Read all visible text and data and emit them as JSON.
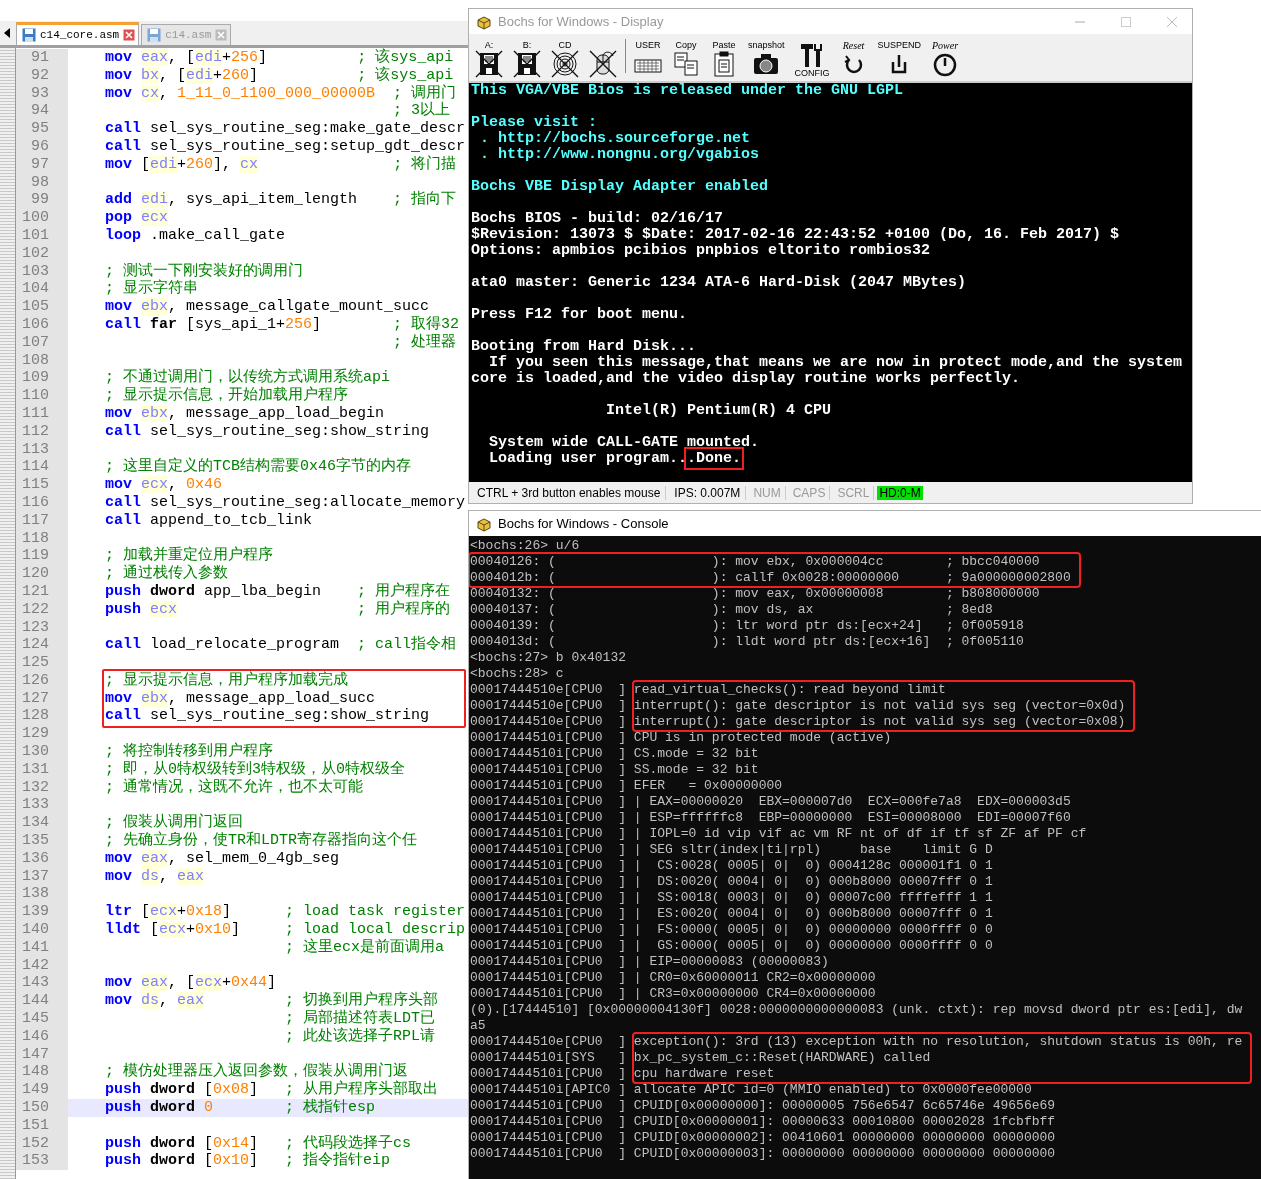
{
  "editor": {
    "tabs": [
      {
        "label": "c14_core.asm",
        "selected": true
      },
      {
        "label": "c14.asm",
        "selected": false
      }
    ],
    "blocks": [
      {
        "boxed": false,
        "lines": [
          {
            "num": "91",
            "current": false,
            "parts": [
              {
                "text": "mov ",
                "kind": "kw"
              },
              {
                "text": "eax",
                "kind": "reg"
              },
              {
                "text": ", [",
                "kind": "txt"
              },
              {
                "text": "edi",
                "kind": "reg"
              },
              {
                "text": "+",
                "kind": "txt"
              },
              {
                "text": "256",
                "kind": "num"
              },
              {
                "text": "]          ",
                "kind": "txt"
              },
              {
                "text": "; 该sys_api",
                "kind": "cmt"
              }
            ]
          },
          {
            "num": "92",
            "current": false,
            "parts": [
              {
                "text": "mov ",
                "kind": "kw"
              },
              {
                "text": "bx",
                "kind": "reg"
              },
              {
                "text": ", [",
                "kind": "txt"
              },
              {
                "text": "edi",
                "kind": "reg"
              },
              {
                "text": "+",
                "kind": "txt"
              },
              {
                "text": "260",
                "kind": "num"
              },
              {
                "text": "]           ",
                "kind": "txt"
              },
              {
                "text": "; 该sys_api",
                "kind": "cmt"
              }
            ]
          },
          {
            "num": "93",
            "current": false,
            "parts": [
              {
                "text": "mov ",
                "kind": "kw"
              },
              {
                "text": "cx",
                "kind": "reg"
              },
              {
                "text": ", ",
                "kind": "txt"
              },
              {
                "text": "1_11_0_1100_000_00000B",
                "kind": "num"
              },
              {
                "text": "  ; 调用门",
                "kind": "cmt"
              }
            ]
          },
          {
            "num": "94",
            "current": false,
            "parts": [
              {
                "text": "                                ; 3以上",
                "kind": "cmt"
              }
            ]
          },
          {
            "num": "95",
            "current": false,
            "parts": [
              {
                "text": "call",
                "kind": "kw"
              },
              {
                "text": " sel_sys_routine_seg:make_gate_descr",
                "kind": "txt"
              }
            ]
          },
          {
            "num": "96",
            "current": false,
            "parts": [
              {
                "text": "call",
                "kind": "kw"
              },
              {
                "text": " sel_sys_routine_seg:setup_gdt_descr",
                "kind": "txt"
              }
            ]
          },
          {
            "num": "97",
            "current": false,
            "parts": [
              {
                "text": "mov",
                "kind": "kw"
              },
              {
                "text": " [",
                "kind": "txt"
              },
              {
                "text": "edi",
                "kind": "reg"
              },
              {
                "text": "+",
                "kind": "txt"
              },
              {
                "text": "260",
                "kind": "num"
              },
              {
                "text": "], ",
                "kind": "txt"
              },
              {
                "text": "cx",
                "kind": "reg"
              },
              {
                "text": "               ; 将门描",
                "kind": "cmt"
              }
            ]
          },
          {
            "num": "98",
            "current": false
          },
          {
            "num": "99",
            "current": false,
            "parts": [
              {
                "text": "add ",
                "kind": "kw"
              },
              {
                "text": "edi",
                "kind": "reg"
              },
              {
                "text": ", sys_api_item_length    ",
                "kind": "txt"
              },
              {
                "text": "; 指向下",
                "kind": "cmt"
              }
            ]
          },
          {
            "num": "100",
            "current": false,
            "parts": [
              {
                "text": "pop ",
                "kind": "kw"
              },
              {
                "text": "ecx",
                "kind": "reg"
              }
            ]
          },
          {
            "num": "101",
            "current": false,
            "parts": [
              {
                "text": "loop",
                "kind": "kw"
              },
              {
                "text": " .make_call_gate",
                "kind": "txt"
              }
            ]
          },
          {
            "num": "102",
            "current": false
          },
          {
            "num": "103",
            "current": false,
            "parts": [
              {
                "text": "; 测试一下刚安装好的调用门",
                "kind": "cmt"
              }
            ]
          },
          {
            "num": "104",
            "current": false,
            "parts": [
              {
                "text": "; 显示字符串",
                "kind": "cmt"
              }
            ]
          },
          {
            "num": "105",
            "current": false,
            "parts": [
              {
                "text": "mov ",
                "kind": "kw"
              },
              {
                "text": "ebx",
                "kind": "reg"
              },
              {
                "text": ", message_callgate_mount_succ",
                "kind": "txt"
              }
            ]
          },
          {
            "num": "106",
            "current": false,
            "parts": [
              {
                "text": "call ",
                "kind": "kw"
              },
              {
                "text": "far",
                "kind": "kw2"
              },
              {
                "text": " [sys_api_1+",
                "kind": "txt"
              },
              {
                "text": "256",
                "kind": "num"
              },
              {
                "text": "]        ",
                "kind": "txt"
              },
              {
                "text": "; 取得32",
                "kind": "cmt"
              }
            ]
          },
          {
            "num": "107",
            "current": false,
            "parts": [
              {
                "text": "                                ; 处理器",
                "kind": "cmt"
              }
            ]
          },
          {
            "num": "108",
            "current": false
          },
          {
            "num": "109",
            "current": false,
            "parts": [
              {
                "text": "; 不通过调用门，以传统方式调用系统api",
                "kind": "cmt"
              }
            ]
          },
          {
            "num": "110",
            "current": false,
            "parts": [
              {
                "text": "; 显示提示信息，开始加载用户程序",
                "kind": "cmt"
              }
            ]
          },
          {
            "num": "111",
            "current": false,
            "parts": [
              {
                "text": "mov ",
                "kind": "kw"
              },
              {
                "text": "ebx",
                "kind": "reg"
              },
              {
                "text": ", message_app_load_begin",
                "kind": "txt"
              }
            ]
          },
          {
            "num": "112",
            "current": false,
            "parts": [
              {
                "text": "call",
                "kind": "kw"
              },
              {
                "text": " sel_sys_routine_seg:show_string",
                "kind": "txt"
              }
            ]
          },
          {
            "num": "113",
            "current": false
          },
          {
            "num": "114",
            "current": false,
            "parts": [
              {
                "text": "; 这里自定义的TCB结构需要0x46字节的内存",
                "kind": "cmt"
              }
            ]
          },
          {
            "num": "115",
            "current": false,
            "parts": [
              {
                "text": "mov ",
                "kind": "kw"
              },
              {
                "text": "ecx",
                "kind": "reg"
              },
              {
                "text": ", ",
                "kind": "txt"
              },
              {
                "text": "0x46",
                "kind": "num"
              }
            ]
          },
          {
            "num": "116",
            "current": false,
            "parts": [
              {
                "text": "call",
                "kind": "kw"
              },
              {
                "text": " sel_sys_routine_seg:allocate_memory",
                "kind": "txt"
              }
            ]
          },
          {
            "num": "117",
            "current": false,
            "parts": [
              {
                "text": "call",
                "kind": "kw"
              },
              {
                "text": " append_to_tcb_link",
                "kind": "txt"
              }
            ]
          },
          {
            "num": "118",
            "current": false
          },
          {
            "num": "119",
            "current": false,
            "parts": [
              {
                "text": "; 加载并重定位用户程序",
                "kind": "cmt"
              }
            ]
          },
          {
            "num": "120",
            "current": false,
            "parts": [
              {
                "text": "; 通过栈传入参数",
                "kind": "cmt"
              }
            ]
          },
          {
            "num": "121",
            "current": false,
            "parts": [
              {
                "text": "push ",
                "kind": "kw"
              },
              {
                "text": "dword",
                "kind": "kw2"
              },
              {
                "text": " app_lba_begin    ",
                "kind": "txt"
              },
              {
                "text": "; 用户程序在",
                "kind": "cmt"
              }
            ]
          },
          {
            "num": "122",
            "current": false,
            "parts": [
              {
                "text": "push ",
                "kind": "kw"
              },
              {
                "text": "ecx",
                "kind": "reg"
              },
              {
                "text": "                    ; 用户程序的",
                "kind": "cmt"
              }
            ]
          },
          {
            "num": "123",
            "current": false
          },
          {
            "num": "124",
            "current": false,
            "parts": [
              {
                "text": "call",
                "kind": "kw"
              },
              {
                "text": " load_relocate_program  ",
                "kind": "txt"
              },
              {
                "text": "; call指令相",
                "kind": "cmt"
              }
            ]
          },
          {
            "num": "125",
            "current": false
          }
        ]
      },
      {
        "boxed": true,
        "lines": [
          {
            "num": "126",
            "current": false,
            "parts": [
              {
                "text": "; 显示提示信息，用户程序加载完成",
                "kind": "cmt"
              }
            ]
          },
          {
            "num": "127",
            "current": false,
            "parts": [
              {
                "text": "mov ",
                "kind": "kw"
              },
              {
                "text": "ebx",
                "kind": "reg"
              },
              {
                "text": ", message_app_load_succ",
                "kind": "txt"
              }
            ]
          },
          {
            "num": "128",
            "current": false,
            "parts": [
              {
                "text": "call",
                "kind": "kw"
              },
              {
                "text": " sel_sys_routine_seg:show_string",
                "kind": "txt"
              }
            ]
          }
        ]
      },
      {
        "boxed": false,
        "lines": [
          {
            "num": "129",
            "current": false
          },
          {
            "num": "130",
            "current": false,
            "parts": [
              {
                "text": "; 将控制转移到用户程序",
                "kind": "cmt"
              }
            ]
          },
          {
            "num": "131",
            "current": false,
            "parts": [
              {
                "text": "; 即，从0特权级转到3特权级，从0特权级全",
                "kind": "cmt"
              }
            ]
          },
          {
            "num": "132",
            "current": false,
            "parts": [
              {
                "text": "; 通常情况，这既不允许，也不太可能",
                "kind": "cmt"
              }
            ]
          },
          {
            "num": "133",
            "current": false
          },
          {
            "num": "134",
            "current": false,
            "parts": [
              {
                "text": "; 假装从调用门返回",
                "kind": "cmt"
              }
            ]
          },
          {
            "num": "135",
            "current": false,
            "parts": [
              {
                "text": "; 先确立身份，使TR和LDTR寄存器指向这个任",
                "kind": "cmt"
              }
            ]
          },
          {
            "num": "136",
            "current": false,
            "parts": [
              {
                "text": "mov ",
                "kind": "kw"
              },
              {
                "text": "eax",
                "kind": "reg"
              },
              {
                "text": ", sel_mem_0_4gb_seg",
                "kind": "txt"
              }
            ]
          },
          {
            "num": "137",
            "current": false,
            "parts": [
              {
                "text": "mov ",
                "kind": "kw"
              },
              {
                "text": "ds",
                "kind": "reg"
              },
              {
                "text": ", ",
                "kind": "txt"
              },
              {
                "text": "eax",
                "kind": "reg"
              }
            ]
          },
          {
            "num": "138",
            "current": false
          },
          {
            "num": "139",
            "current": false,
            "parts": [
              {
                "text": "ltr",
                "kind": "kw"
              },
              {
                "text": " [",
                "kind": "txt"
              },
              {
                "text": "ecx",
                "kind": "reg"
              },
              {
                "text": "+",
                "kind": "txt"
              },
              {
                "text": "0x18",
                "kind": "num"
              },
              {
                "text": "]      ",
                "kind": "txt"
              },
              {
                "text": "; load task register",
                "kind": "cmt"
              }
            ]
          },
          {
            "num": "140",
            "current": false,
            "parts": [
              {
                "text": "lldt",
                "kind": "kw"
              },
              {
                "text": " [",
                "kind": "txt"
              },
              {
                "text": "ecx",
                "kind": "reg"
              },
              {
                "text": "+",
                "kind": "txt"
              },
              {
                "text": "0x10",
                "kind": "num"
              },
              {
                "text": "]     ",
                "kind": "txt"
              },
              {
                "text": "; load local descrip",
                "kind": "cmt"
              }
            ]
          },
          {
            "num": "141",
            "current": false,
            "parts": [
              {
                "text": "                    ; 这里ecx是前面调用a",
                "kind": "cmt"
              }
            ]
          },
          {
            "num": "142",
            "current": false
          },
          {
            "num": "143",
            "current": false,
            "parts": [
              {
                "text": "mov ",
                "kind": "kw"
              },
              {
                "text": "eax",
                "kind": "reg"
              },
              {
                "text": ", [",
                "kind": "txt"
              },
              {
                "text": "ecx",
                "kind": "reg"
              },
              {
                "text": "+",
                "kind": "txt"
              },
              {
                "text": "0x44",
                "kind": "num"
              },
              {
                "text": "]",
                "kind": "txt"
              }
            ]
          },
          {
            "num": "144",
            "current": false,
            "parts": [
              {
                "text": "mov ",
                "kind": "kw"
              },
              {
                "text": "ds",
                "kind": "reg"
              },
              {
                "text": ", ",
                "kind": "txt"
              },
              {
                "text": "eax",
                "kind": "reg"
              },
              {
                "text": "         ; 切换到用户程序头部",
                "kind": "cmt"
              }
            ]
          },
          {
            "num": "145",
            "current": false,
            "parts": [
              {
                "text": "                    ; 局部描述符表LDT已",
                "kind": "cmt"
              }
            ]
          },
          {
            "num": "146",
            "current": false,
            "parts": [
              {
                "text": "                    ; 此处该选择子RPL请",
                "kind": "cmt"
              }
            ]
          },
          {
            "num": "147",
            "current": false
          },
          {
            "num": "148",
            "current": false,
            "parts": [
              {
                "text": "; 模仿处理器压入返回参数，假装从调用门返",
                "kind": "cmt"
              }
            ]
          },
          {
            "num": "149",
            "current": false,
            "parts": [
              {
                "text": "push ",
                "kind": "kw"
              },
              {
                "text": "dword",
                "kind": "kw2"
              },
              {
                "text": " [",
                "kind": "txt"
              },
              {
                "text": "0x08",
                "kind": "num"
              },
              {
                "text": "]   ",
                "kind": "txt"
              },
              {
                "text": "; 从用户程序头部取出",
                "kind": "cmt"
              }
            ]
          },
          {
            "num": "150",
            "current": true,
            "parts": [
              {
                "text": "push ",
                "kind": "kw"
              },
              {
                "text": "dword",
                "kind": "kw2"
              },
              {
                "text": " 0",
                "kind": "num"
              },
              {
                "text": "        ; 栈指针esp",
                "kind": "cmt"
              }
            ]
          },
          {
            "num": "151",
            "current": false
          },
          {
            "num": "152",
            "current": false,
            "parts": [
              {
                "text": "push ",
                "kind": "kw"
              },
              {
                "text": "dword",
                "kind": "kw2"
              },
              {
                "text": " [",
                "kind": "txt"
              },
              {
                "text": "0x14",
                "kind": "num"
              },
              {
                "text": "]   ",
                "kind": "txt"
              },
              {
                "text": "; 代码段选择子cs",
                "kind": "cmt"
              }
            ]
          },
          {
            "num": "153",
            "current": false,
            "parts": [
              {
                "text": "push ",
                "kind": "kw"
              },
              {
                "text": "dword",
                "kind": "kw2"
              },
              {
                "text": " [",
                "kind": "txt"
              },
              {
                "text": "0x10",
                "kind": "num"
              },
              {
                "text": "]   ",
                "kind": "txt"
              },
              {
                "text": "; 指令指针eip",
                "kind": "cmt"
              }
            ]
          }
        ]
      }
    ]
  },
  "display": {
    "title": "Bochs for Windows - Display",
    "toolbar": [
      {
        "kind": "floppy",
        "label": "A:",
        "disabled": true
      },
      {
        "kind": "floppy",
        "label": "B:",
        "disabled": true
      },
      {
        "kind": "cdrom",
        "label": "CD",
        "disabled": true
      },
      {
        "kind": "mouse",
        "disabled": true
      },
      {
        "kind": "user",
        "label": "USER",
        "disabled": false
      },
      {
        "kind": "copy",
        "label": "Copy",
        "disabled": false
      },
      {
        "kind": "paste",
        "label": "Paste",
        "disabled": false
      },
      {
        "kind": "snapshot",
        "label": "snapshot",
        "disabled": false
      },
      {
        "kind": "config",
        "label": "CONFIG",
        "disabled": false
      },
      {
        "kind": "reset",
        "label": "Reset",
        "disabled": false
      },
      {
        "kind": "suspend",
        "label": "SUSPEND",
        "disabled": false
      },
      {
        "kind": "power",
        "label": "Power",
        "disabled": false
      }
    ],
    "screen": [
      [
        {
          "text": "This VGA/VBE Bios is released under the GNU LGPL",
          "color": "#55ffff"
        }
      ],
      [
        {
          "text": "Please visit :",
          "color": "#55ffff"
        },
        {
          "text": " . http://bochs.sourceforge.net",
          "color": "#55ffff"
        },
        {
          "text": " . http://www.nongnu.org/vgabios",
          "color": "#55ffff"
        }
      ],
      [
        {
          "text": "Bochs VBE Display Adapter enabled",
          "color": "#55ffff"
        }
      ],
      [
        {
          "text": "Bochs BIOS - build: 02/16/17",
          "color": "#ffffff"
        },
        {
          "text": "$Revision: 13073 $ $Date: 2017-02-16 22:43:52 +0100 (Do, 16. Feb 2017) $",
          "color": "#ffffff"
        },
        {
          "text": "Options: apmbios pcibios pnpbios eltorito rombios32",
          "color": "#ffffff"
        }
      ],
      [
        {
          "text": "ata0 master: Generic 1234 ATA-6 Hard-Disk (2047 MBytes)",
          "color": "#ffffff"
        }
      ],
      [
        {
          "text": "Press F12 for boot menu.",
          "color": "#ffffff"
        }
      ],
      [
        {
          "text": "Booting from Hard Disk...",
          "color": "#ffffff"
        },
        {
          "text": "  If you seen this message,that means we are now in protect mode,and the system",
          "color": "#ffffff"
        },
        {
          "text": "core is loaded,and the video display routine works perfectly.",
          "color": "#ffffff"
        }
      ],
      [
        {
          "text": "               Intel(R) Pentium(R) 4 CPU",
          "color": "#ffffff"
        }
      ],
      [
        {
          "text": "  System wide CALL-GATE mounted.",
          "color": "#ffffff"
        },
        {
          "text": "  Loading user program..",
          "boxed": ".Done.",
          "color": "#ffffff"
        }
      ]
    ],
    "status": [
      {
        "kind": "message",
        "text": "CTRL + 3rd button enables mouse"
      },
      {
        "kind": "message",
        "text": "IPS: 0.007M"
      },
      {
        "kind": "indicator",
        "text": "NUM",
        "on": false
      },
      {
        "kind": "indicator",
        "text": "CAPS",
        "on": false
      },
      {
        "kind": "indicator",
        "text": "SCRL",
        "on": false
      },
      {
        "kind": "led",
        "text": "HD:0-M",
        "on": true
      }
    ]
  },
  "console": {
    "title": "Bochs for Windows - Console",
    "blocks": [
      {
        "boxed": false,
        "lines": [
          {
            "text": "<bochs:26> u/6"
          }
        ]
      },
      {
        "boxed": true,
        "lines": [
          {
            "text": "00040126: (                    ): mov ebx, 0x000004cc        ; bbcc040000"
          },
          {
            "text": "0004012b: (                    ): callf 0x0028:00000000      ; 9a000000002800"
          }
        ]
      },
      {
        "boxed": false,
        "lines": [
          {
            "text": "00040132: (                    ): mov eax, 0x00000008        ; b808000000"
          },
          {
            "text": "00040137: (                    ): mov ds, ax                 ; 8ed8"
          },
          {
            "text": "00040139: (                    ): ltr word ptr ds:[ecx+24]   ; 0f005918"
          },
          {
            "text": "0004013d: (                    ): lldt word ptr ds:[ecx+16]  ; 0f005110"
          },
          {
            "text": "<bochs:27> b 0x40132"
          },
          {
            "text": "<bochs:28> c"
          }
        ]
      },
      {
        "boxed": true,
        "lines": [
          {
            "prefix": "00017444510e[CPU0  ]",
            "text": "read_virtual_checks(): read beyond limit"
          },
          {
            "prefix": "00017444510e[CPU0  ]",
            "text": "interrupt(): gate descriptor is not valid sys seg (vector=0x0d)"
          },
          {
            "prefix": "00017444510e[CPU0  ]",
            "text": "interrupt(): gate descriptor is not valid sys seg (vector=0x08)"
          }
        ]
      },
      {
        "boxed": false,
        "lines": [
          {
            "prefix": "00017444510i[CPU0  ]",
            "text": "CPU is in protected mode (active)"
          },
          {
            "prefix": "00017444510i[CPU0  ]",
            "text": "CS.mode = 32 bit"
          },
          {
            "prefix": "00017444510i[CPU0  ]",
            "text": "SS.mode = 32 bit"
          },
          {
            "prefix": "00017444510i[CPU0  ]",
            "text": "EFER   = 0x00000000"
          },
          {
            "prefix": "00017444510i[CPU0  ]",
            "text": "| EAX=00000020  EBX=000007d0  ECX=000fe7a8  EDX=000003d5"
          },
          {
            "prefix": "00017444510i[CPU0  ]",
            "text": "| ESP=ffffffc8  EBP=00000000  ESI=00008000  EDI=00007f60"
          },
          {
            "prefix": "00017444510i[CPU0  ]",
            "text": "| IOPL=0 id vip vif ac vm RF nt of df if tf sf ZF af PF cf"
          },
          {
            "prefix": "00017444510i[CPU0  ]",
            "text": "| SEG sltr(index|ti|rpl)     base    limit G D"
          },
          {
            "prefix": "00017444510i[CPU0  ]",
            "text": "|  CS:0028( 0005| 0|  0) 0004128c 000001f1 0 1"
          },
          {
            "prefix": "00017444510i[CPU0  ]",
            "text": "|  DS:0020( 0004| 0|  0) 000b8000 00007fff 0 1"
          },
          {
            "prefix": "00017444510i[CPU0  ]",
            "text": "|  SS:0018( 0003| 0|  0) 00007c00 ffffefff 1 1"
          },
          {
            "prefix": "00017444510i[CPU0  ]",
            "text": "|  ES:0020( 0004| 0|  0) 000b8000 00007fff 0 1"
          },
          {
            "prefix": "00017444510i[CPU0  ]",
            "text": "|  FS:0000( 0005| 0|  0) 00000000 0000ffff 0 0"
          },
          {
            "prefix": "00017444510i[CPU0  ]",
            "text": "|  GS:0000( 0005| 0|  0) 00000000 0000ffff 0 0"
          },
          {
            "prefix": "00017444510i[CPU0  ]",
            "text": "| EIP=00000083 (00000083)"
          },
          {
            "prefix": "00017444510i[CPU0  ]",
            "text": "| CR0=0x60000011 CR2=0x00000000"
          },
          {
            "prefix": "00017444510i[CPU0  ]",
            "text": "| CR3=0x00000000 CR4=0x00000000"
          }
        ]
      },
      {
        "boxed": false,
        "lines": [
          {
            "text": "(0).[17444510] [0x00000004130f] 0028:0000000000000083 (unk. ctxt): rep movsd dword ptr es:[edi], dw"
          },
          {
            "text": "a5"
          }
        ]
      },
      {
        "boxed": true,
        "lines": [
          {
            "prefix": "00017444510e[CPU0  ]",
            "text": "exception(): 3rd (13) exception with no resolution, shutdown status is 00h, re"
          },
          {
            "prefix": "00017444510i[SYS   ]",
            "text": "bx_pc_system_c::Reset(HARDWARE) called"
          },
          {
            "prefix": "00017444510i[CPU0  ]",
            "text": "cpu hardware reset"
          }
        ]
      },
      {
        "boxed": false,
        "lines": [
          {
            "prefix": "00017444510i[APIC0 ]",
            "text": "allocate APIC id=0 (MMIO enabled) to 0x0000fee00000"
          },
          {
            "prefix": "00017444510i[CPU0  ]",
            "text": "CPUID[0x00000000]: 00000005 756e6547 6c65746e 49656e69"
          },
          {
            "prefix": "00017444510i[CPU0  ]",
            "text": "CPUID[0x00000001]: 00000633 00010800 00002028 1fcbfbff"
          },
          {
            "prefix": "00017444510i[CPU0  ]",
            "text": "CPUID[0x00000002]: 00410601 00000000 00000000 00000000"
          },
          {
            "prefix": "00017444510i[CPU0  ]",
            "text": "CPUID[0x00000003]: 00000000 00000000 00000000 00000000"
          }
        ]
      }
    ]
  }
}
